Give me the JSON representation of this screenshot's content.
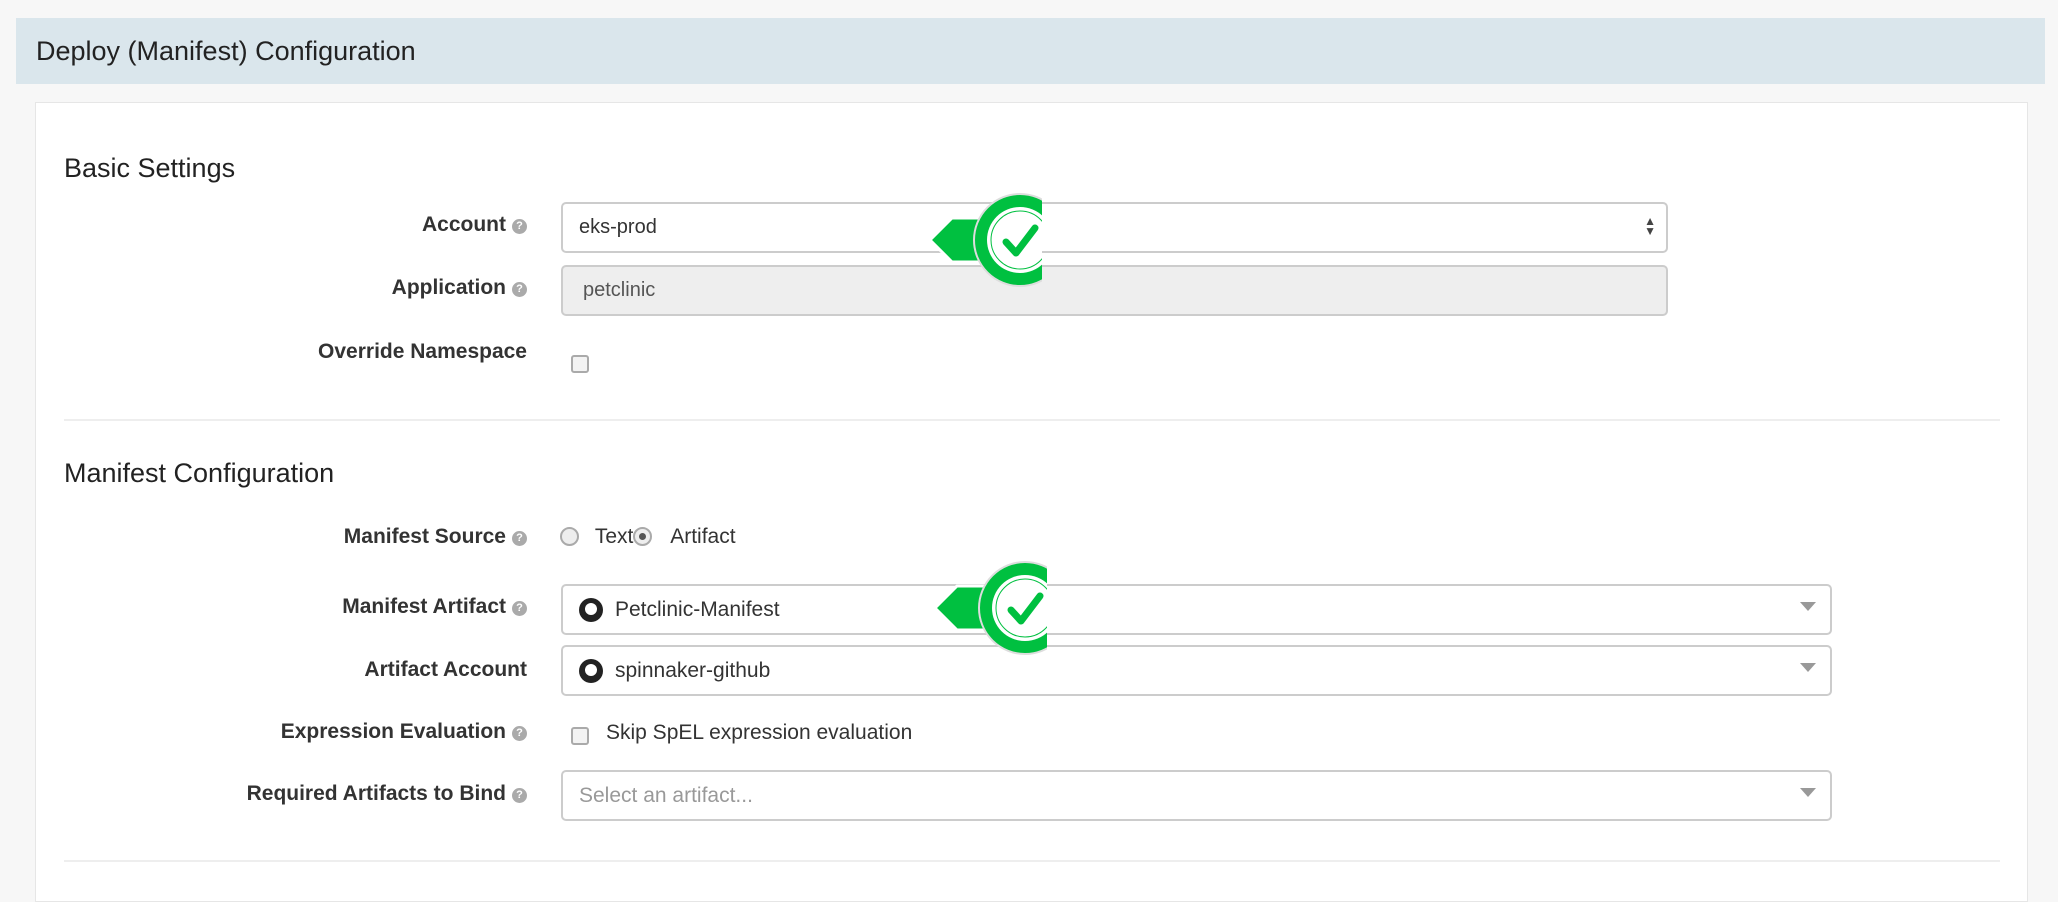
{
  "header": {
    "title": "Deploy (Manifest) Configuration"
  },
  "basic": {
    "title": "Basic Settings",
    "account_label": "Account",
    "account_value": "eks-prod",
    "application_label": "Application",
    "application_value": "petclinic",
    "override_label": "Override Namespace",
    "override_checked": false
  },
  "manifest": {
    "title": "Manifest Configuration",
    "source_label": "Manifest Source",
    "source_text": "Text",
    "source_artifact": "Artifact",
    "source_selected": "Artifact",
    "artifact_label": "Manifest Artifact",
    "artifact_value": "Petclinic-Manifest",
    "account_label": "Artifact Account",
    "account_value": "spinnaker-github",
    "expr_label": "Expression Evaluation",
    "expr_checkbox_label": "Skip SpEL expression evaluation",
    "expr_checked": false,
    "required_label": "Required Artifacts to Bind",
    "required_placeholder": "Select an artifact..."
  },
  "help_glyph": "?",
  "colors": {
    "accent_green": "#00c040",
    "header_bg": "#dae6ec"
  }
}
